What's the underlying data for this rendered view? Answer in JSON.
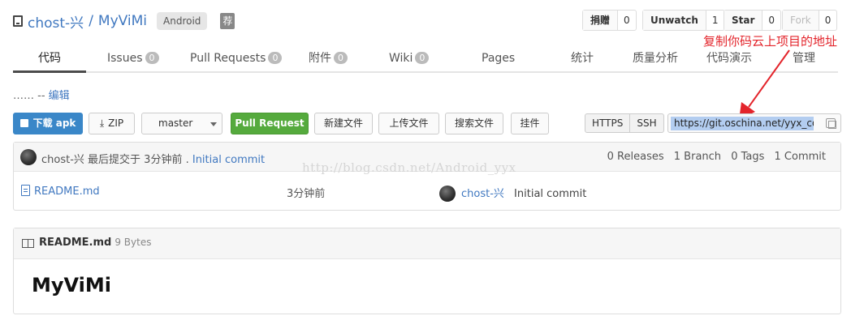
{
  "header": {
    "owner": "chost-兴",
    "separator": "/",
    "repo": "MyViMi",
    "language_badge": "Android",
    "recommend_icon": "荐",
    "donate": {
      "label": "捐赠",
      "count": "0"
    },
    "watch": {
      "label": "Unwatch",
      "count": "1"
    },
    "star": {
      "label": "Star",
      "count": "0"
    },
    "fork": {
      "label": "Fork",
      "count": "0"
    }
  },
  "tabs": [
    {
      "label": "代码"
    },
    {
      "label": "Issues",
      "count": "0"
    },
    {
      "label": "Pull Requests",
      "count": "0"
    },
    {
      "label": "附件",
      "count": "0"
    },
    {
      "label": "Wiki",
      "count": "0"
    },
    {
      "label": "Pages"
    },
    {
      "label": "统计"
    },
    {
      "label": "质量分析"
    },
    {
      "label": "代码演示"
    },
    {
      "label": "管理"
    }
  ],
  "annotation": "复制你码云上项目的地址",
  "description": {
    "text": "……   -- ",
    "edit_link": "编辑"
  },
  "toolbar": {
    "download_apk": "下载 apk",
    "zip": "ZIP",
    "branch": "master",
    "pull_request": "Pull Request",
    "new_file": "新建文件",
    "upload_file": "上传文件",
    "search_file": "搜索文件",
    "widget": "挂件",
    "https": "HTTPS",
    "ssh": "SSH",
    "clone_url": "https://git.oschina.net/yyx_code/MyViMi.git"
  },
  "commit": {
    "author": "chost-兴",
    "text": "最后提交于 3分钟前 .",
    "message": "Initial commit",
    "releases": "0 Releases",
    "branches": "1 Branch",
    "tags": "0 Tags",
    "commits": "1 Commit"
  },
  "files": [
    {
      "name": "README.md",
      "time": "3分钟前",
      "author": "chost-兴",
      "message": "Initial commit"
    }
  ],
  "watermark": "http://blog.csdn.net/Android_yyx",
  "readme": {
    "filename": "README.md",
    "size": "9 Bytes",
    "heading": "MyViMi"
  },
  "colors": {
    "link": "#4078c0",
    "primary_button": "#3a87c8",
    "success_button": "#55aa3d",
    "annotation": "#e3242b"
  }
}
